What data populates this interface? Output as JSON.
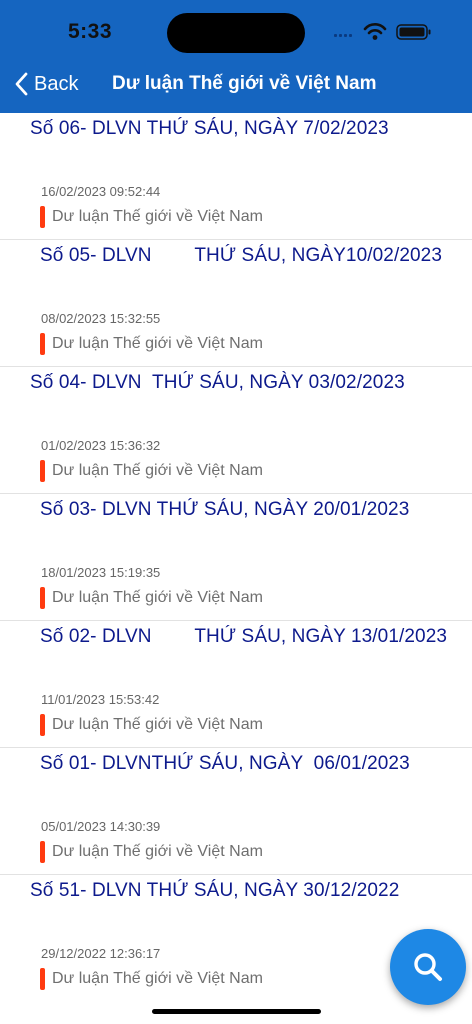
{
  "status_bar": {
    "time": "5:33"
  },
  "nav": {
    "back_label": "Back",
    "title": "Dư luận Thế giới về Việt Nam"
  },
  "articles": [
    {
      "title": "Số 06- DLVN THỨ SÁU, NGÀY 7/02/2023",
      "date": "16/02/2023 09:52:44",
      "category": "Dư luận Thế giới về Việt Nam"
    },
    {
      "title": "Số 05- DLVN        THỨ SÁU, NGÀY10/02/2023",
      "date": "08/02/2023 15:32:55",
      "category": "Dư luận Thế giới về Việt Nam"
    },
    {
      "title": "Số 04- DLVN  THỨ SÁU, NGÀY 03/02/2023",
      "date": "01/02/2023 15:36:32",
      "category": "Dư luận Thế giới về Việt Nam"
    },
    {
      "title": "Số 03- DLVN THỨ SÁU, NGÀY 20/01/2023",
      "date": "18/01/2023 15:19:35",
      "category": "Dư luận Thế giới về Việt Nam"
    },
    {
      "title": "Số 02- DLVN        THỨ SÁU, NGÀY 13/01/2023",
      "date": "11/01/2023 15:53:42",
      "category": "Dư luận Thế giới về Việt Nam"
    },
    {
      "title": "Số 01- DLVNTHỨ SÁU, NGÀY  06/01/2023",
      "date": "05/01/2023 14:30:39",
      "category": "Dư luận Thế giới về Việt Nam"
    },
    {
      "title": "Số 51- DLVN THỨ SÁU, NGÀY 30/12/2022",
      "date": "29/12/2022 12:36:17",
      "category": "Dư luận Thế giới về Việt Nam"
    }
  ],
  "icons": {
    "back": "chevron-left-icon",
    "search": "search-icon",
    "wifi": "wifi-icon",
    "battery": "battery-icon",
    "signal": "cellular-signal-icon"
  },
  "colors": {
    "header": "#1565c0",
    "title_text": "#0d1a8c",
    "category_bar": "#ff3b10",
    "fab": "#1e88e5"
  }
}
